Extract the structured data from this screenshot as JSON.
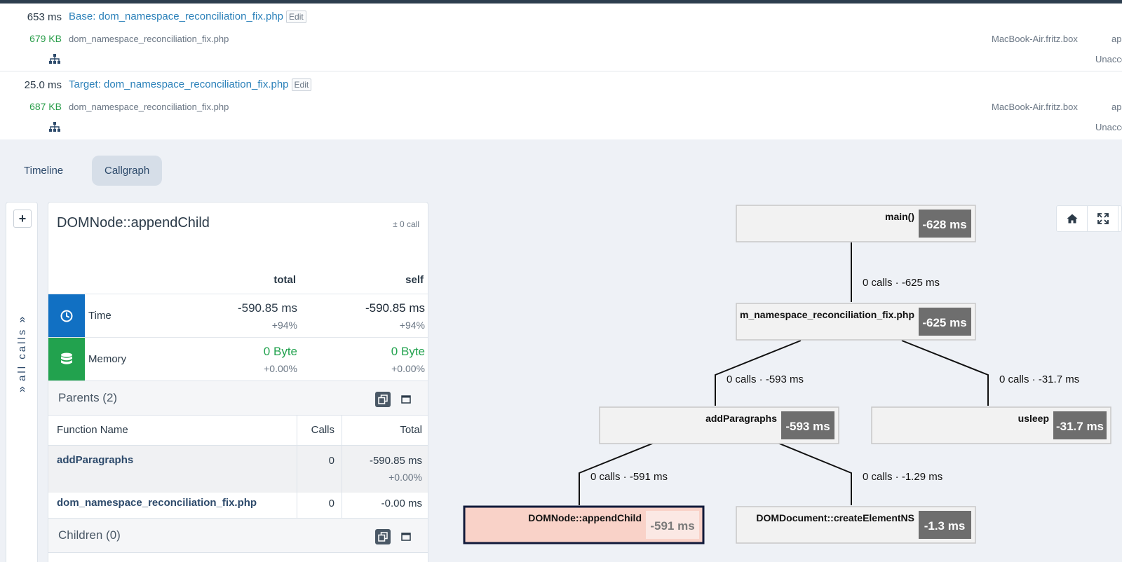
{
  "profiles": [
    {
      "time": "653 ms",
      "title": "Base: dom_namespace_reconciliation_fix.php",
      "edit_label": "Edit",
      "memory": "679 KB",
      "file": "dom_namespace_reconciliation_fix.php",
      "host": "MacBook-Air.fritz.box",
      "extra": "ap",
      "status": "Unacco"
    },
    {
      "time": "25.0 ms",
      "title": "Target: dom_namespace_reconciliation_fix.php",
      "edit_label": "Edit",
      "memory": "687 KB",
      "file": "dom_namespace_reconciliation_fix.php",
      "host": "MacBook-Air.fritz.box",
      "extra": "ap",
      "status": "Unacco"
    }
  ],
  "tabs": [
    {
      "label": "Timeline",
      "active": false
    },
    {
      "label": "Callgraph",
      "active": true
    }
  ],
  "sidebar": {
    "expand_icon": "plus-icon",
    "label": "all calls",
    "chevron": "»"
  },
  "detail": {
    "function_name": "DOMNode::appendChild",
    "calls_delta": "± 0 call",
    "columns": {
      "total": "total",
      "self": "self"
    },
    "metrics": [
      {
        "label": "Time",
        "icon": "clock-icon",
        "color": "#1170c3",
        "total": "-590.85 ms",
        "total_pct": "+94%",
        "self": "-590.85 ms",
        "self_pct": "+94%"
      },
      {
        "label": "Memory",
        "icon": "database-icon",
        "color": "#22a24e",
        "total": "0 Byte",
        "total_pct": "+0.00%",
        "self": "0 Byte",
        "self_pct": "+0.00%"
      }
    ],
    "parents": {
      "title": "Parents (2)",
      "columns": {
        "function": "Function Name",
        "calls": "Calls",
        "total": "Total"
      },
      "rows": [
        {
          "function": "addParagraphs",
          "calls": "0",
          "total": "-590.85 ms",
          "total_pct": "+0.00%"
        },
        {
          "function": "dom_namespace_reconciliation_fix.php",
          "calls": "0",
          "total": "-0.00 ms"
        }
      ]
    },
    "children": {
      "title": "Children (0)"
    }
  },
  "callgraph": {
    "nodes": {
      "main": {
        "name": "main()",
        "value": "-628 ms"
      },
      "script": {
        "name": "m_namespace_reconciliation_fix.php",
        "value": "-625 ms"
      },
      "addParagraphs": {
        "name": "addParagraphs",
        "value": "-593 ms"
      },
      "usleep": {
        "name": "usleep",
        "value": "-31.7 ms"
      },
      "appendChild": {
        "name": "DOMNode::appendChild",
        "value": "-591 ms",
        "selected": true
      },
      "createElementNS": {
        "name": "DOMDocument::createElementNS",
        "value": "-1.3 ms"
      }
    },
    "edges": {
      "main_script": "0 calls · -625 ms",
      "script_add": "0 calls · -593 ms",
      "script_usleep": "0 calls · -31.7 ms",
      "add_append": "0 calls · -591 ms",
      "add_create": "0 calls · -1.29 ms"
    },
    "controls": [
      "home-icon",
      "fullscreen-icon"
    ]
  }
}
